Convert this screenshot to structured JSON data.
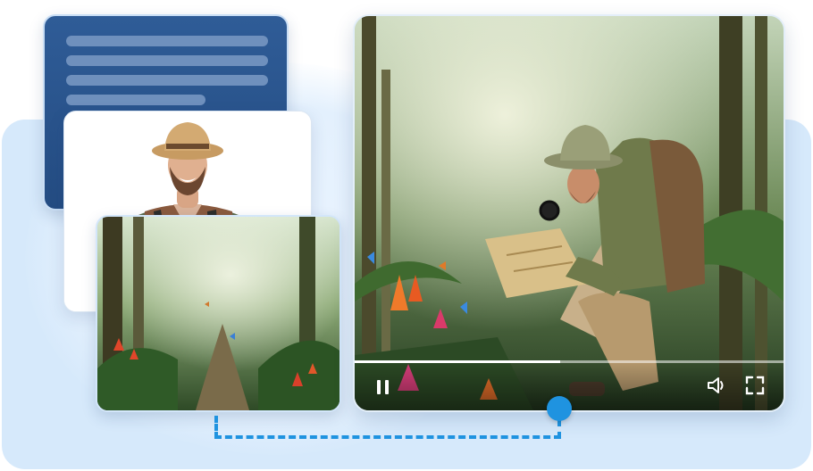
{
  "document_card": {
    "line_count": 4
  },
  "portrait_card": {
    "image": "smiling-explorer-portrait"
  },
  "thumbnail_card": {
    "image": "rainforest-path-with-butterflies"
  },
  "video_player": {
    "image": "explorer-reading-map-in-jungle",
    "progress_fraction": 0.48,
    "controls": {
      "play_pause_icon": "pause-icon",
      "volume_icon": "volume-icon",
      "fullscreen_icon": "fullscreen-icon"
    }
  },
  "timeline_connector": {
    "color": "#1f93e0"
  },
  "colors": {
    "accent": "#1f93e0",
    "background_panel": "#d6e9fb",
    "document_card": "#2f5c97"
  }
}
